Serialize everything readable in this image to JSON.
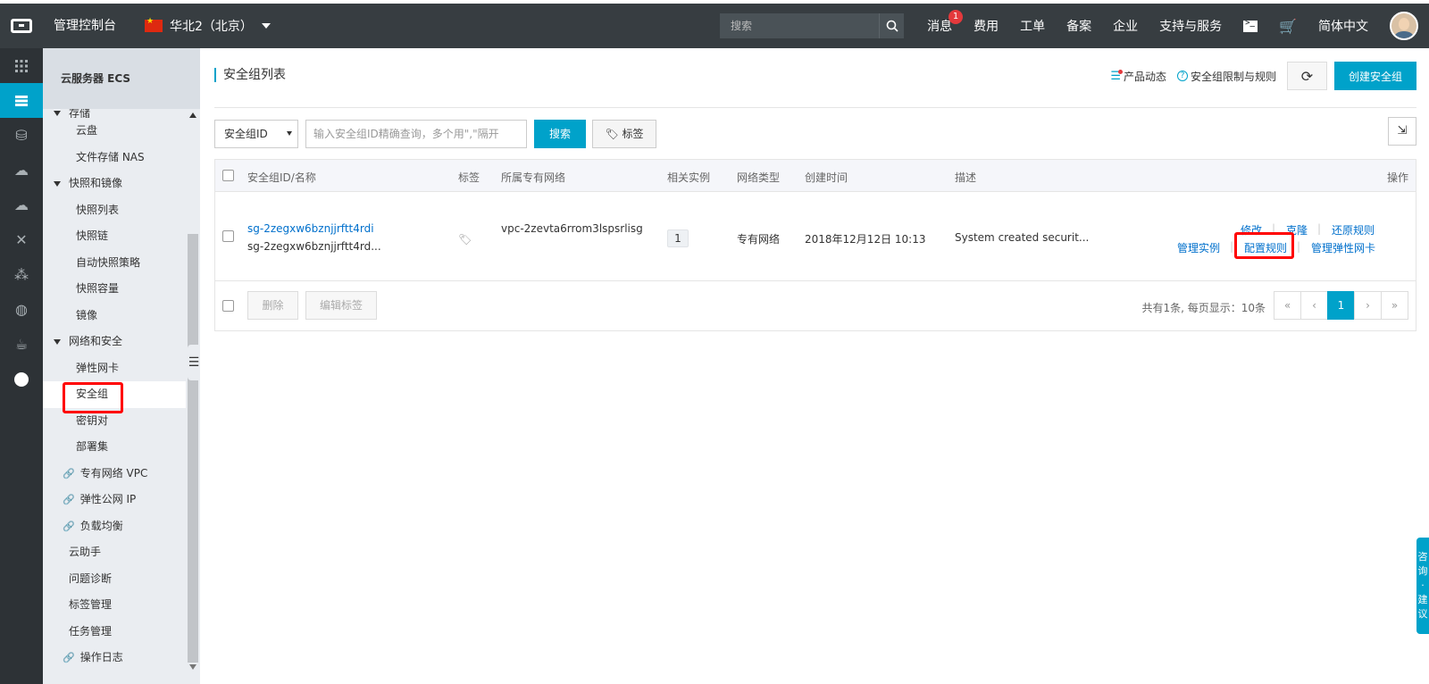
{
  "header": {
    "console_title": "管理控制台",
    "region": "华北2（北京）",
    "search_placeholder": "搜索",
    "nav": [
      {
        "label": "消息",
        "badge": "1"
      },
      {
        "label": "费用"
      },
      {
        "label": "工单"
      },
      {
        "label": "备案"
      },
      {
        "label": "企业"
      },
      {
        "label": "支持与服务"
      }
    ],
    "language": "简体中文"
  },
  "sidebar": {
    "title": "云服务器 ECS",
    "partial_top": "存储",
    "items": [
      {
        "type": "item",
        "label": "云盘"
      },
      {
        "type": "item",
        "label": "文件存储 NAS"
      },
      {
        "type": "group",
        "label": "快照和镜像"
      },
      {
        "type": "item",
        "label": "快照列表"
      },
      {
        "type": "item",
        "label": "快照链"
      },
      {
        "type": "item",
        "label": "自动快照策略"
      },
      {
        "type": "item",
        "label": "快照容量"
      },
      {
        "type": "item",
        "label": "镜像"
      },
      {
        "type": "group",
        "label": "网络和安全"
      },
      {
        "type": "item",
        "label": "弹性网卡"
      },
      {
        "type": "item",
        "label": "安全组",
        "active": true
      },
      {
        "type": "item",
        "label": "密钥对"
      },
      {
        "type": "item",
        "label": "部署集"
      },
      {
        "type": "link",
        "label": "专有网络 VPC"
      },
      {
        "type": "link",
        "label": "弹性公网 IP"
      },
      {
        "type": "link",
        "label": "负载均衡"
      },
      {
        "type": "plain",
        "label": "云助手"
      },
      {
        "type": "plain",
        "label": "问题诊断"
      },
      {
        "type": "plain",
        "label": "标签管理"
      },
      {
        "type": "plain",
        "label": "任务管理"
      },
      {
        "type": "link",
        "label": "操作日志"
      }
    ]
  },
  "main": {
    "title": "安全组列表",
    "product_news": "产品动态",
    "limits_link": "安全组限制与规则",
    "create_button": "创建安全组",
    "filter_select": "安全组ID",
    "query_placeholder": "输入安全组ID精确查询，多个用\",\"隔开",
    "search_button": "搜索",
    "tag_button": "标签",
    "columns": {
      "id_name": "安全组ID/名称",
      "tag": "标签",
      "vpc": "所属专有网络",
      "instances": "相关实例",
      "network_type": "网络类型",
      "created": "创建时间",
      "description": "描述",
      "actions": "操作"
    },
    "rows": [
      {
        "id": "sg-2zegxw6bznjjrftt4rdi",
        "name": "sg-2zegxw6bznjjrftt4rd...",
        "vpc": "vpc-2zevta6rrom3lspsrlisg",
        "instances": "1",
        "network_type": "专有网络",
        "created": "2018年12月12日 10:13",
        "description": "System created securit...",
        "actions": {
          "modify": "修改",
          "clone": "克隆",
          "restore_rules": "还原规则",
          "manage_instances": "管理实例",
          "configure_rules": "配置规则",
          "manage_eni": "管理弹性网卡"
        }
      }
    ],
    "footer": {
      "delete_button": "删除",
      "edit_tags_button": "编辑标签",
      "pager_info": "共有1条, 每页显示：10条",
      "pager": [
        "«",
        "‹",
        "1",
        "›",
        "»"
      ],
      "current_page": "1"
    }
  },
  "float_help": "咨询·建议",
  "colors": {
    "topbar": "#373d41",
    "accent": "#00a2ca",
    "highlight_box": "#ff0000",
    "link": "#0070cc"
  }
}
